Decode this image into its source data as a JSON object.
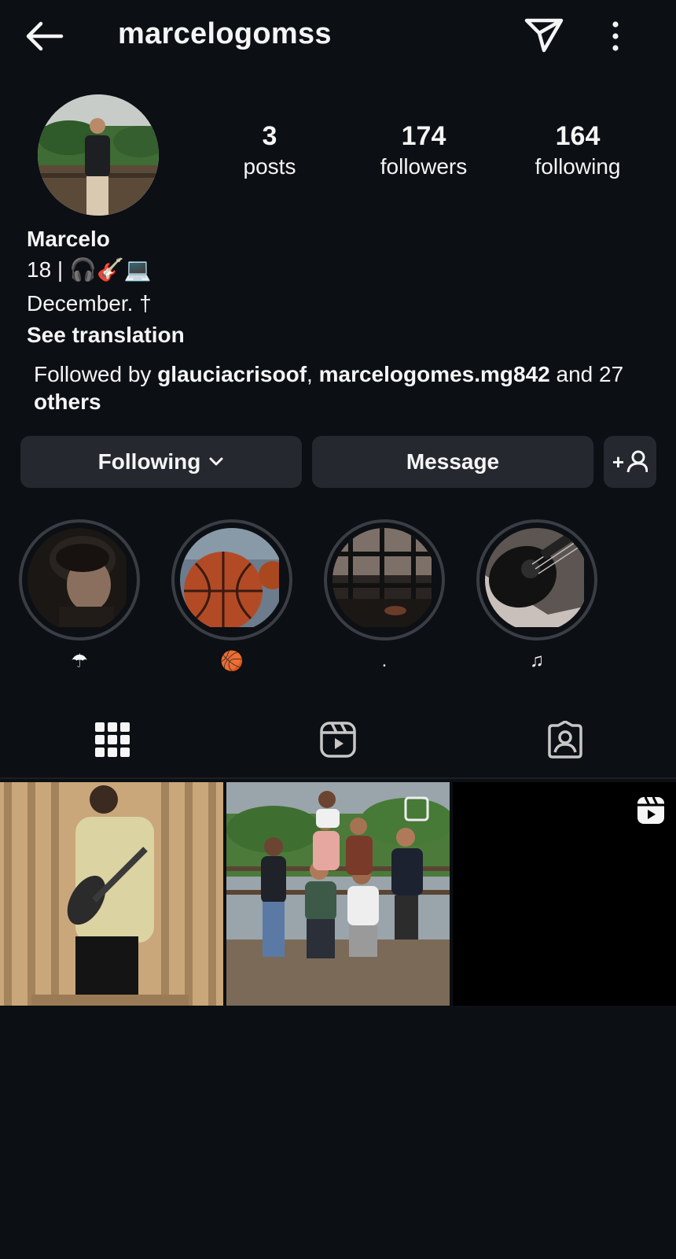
{
  "header": {
    "username": "marcelogomss"
  },
  "stats": [
    {
      "value": "3",
      "label": "posts"
    },
    {
      "value": "174",
      "label": "followers"
    },
    {
      "value": "164",
      "label": "following"
    }
  ],
  "bio": {
    "name": "Marcelo",
    "line1_text": "18 |",
    "line1_emoji": "🎧🎸💻",
    "line2": "December. †",
    "see_translation": "See translation",
    "followed_by_prefix": "Followed by ",
    "follower1": "glauciacrisoof",
    "separator": ", ",
    "follower2": "marcelogomes.mg842",
    "and_text": " and 27",
    "others": "others"
  },
  "buttons": {
    "following": "Following",
    "message": "Message",
    "add_person": "+"
  },
  "highlights": [
    {
      "label": "☂"
    },
    {
      "label": "🏀"
    },
    {
      "label": "."
    },
    {
      "label": "♫"
    }
  ],
  "tabs": [
    "grid-icon",
    "reels-icon",
    "tagged-icon"
  ],
  "colors": {
    "background": "#0c0f14",
    "button": "#25292f",
    "text": "#f5f5f5"
  }
}
